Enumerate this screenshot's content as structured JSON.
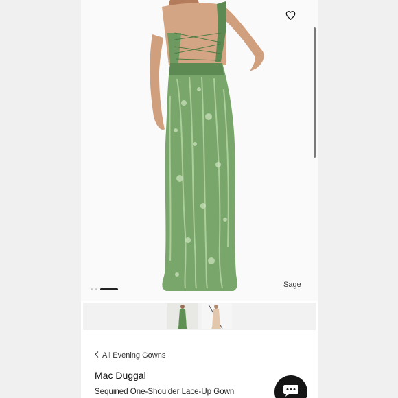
{
  "product": {
    "color_label": "Sage",
    "breadcrumb_label": "All Evening Gowns",
    "brand": "Mac Duggal",
    "name": "Sequined One-Shoulder Lace-Up Gown"
  },
  "gallery": {
    "image_count": 3,
    "active_index": 2
  },
  "icons": {
    "wishlist": "heart-icon",
    "back": "chevron-left-icon",
    "chat": "chat-bubble-icon"
  },
  "colors": {
    "dress": "#79a66a",
    "dress_dark": "#5d8a52",
    "sequin": "#b8d8a8",
    "skin": "#cf9f7e"
  }
}
